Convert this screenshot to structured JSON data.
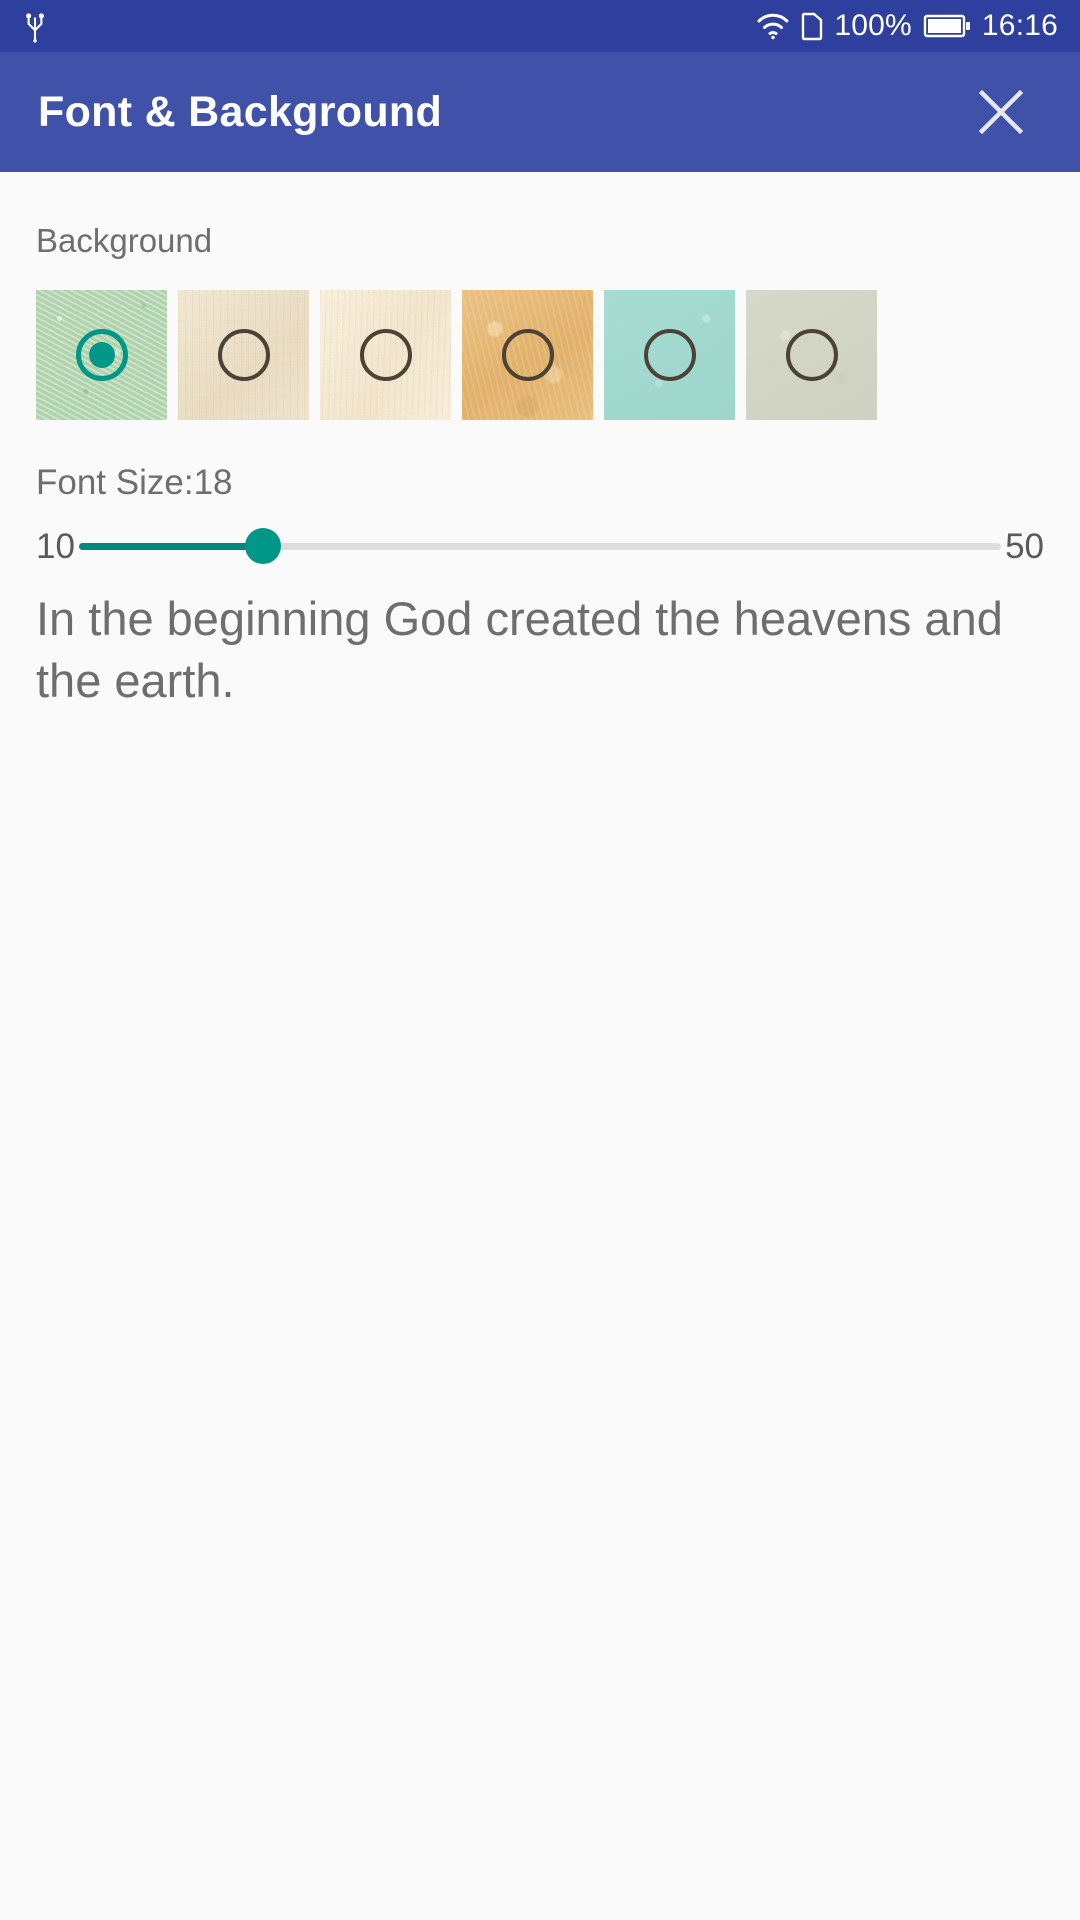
{
  "status_bar": {
    "usb_icon": "usb-icon",
    "wifi_icon": "wifi-icon",
    "sim_icon": "sim-card-icon",
    "battery_percent": "100%",
    "battery_icon": "battery-full-icon",
    "time": "16:16",
    "background_color": "#2E3F9E",
    "foreground_color": "#FFFFFF"
  },
  "app_bar": {
    "title": "Font & Background",
    "close_icon": "close-icon",
    "background_color": "#3F51A8",
    "title_color": "#FFFFFF"
  },
  "content": {
    "background_section": {
      "label": "Background",
      "selected_index": 0,
      "swatches": [
        {
          "name": "sage-green-texture",
          "color": "#B7D8B4",
          "selected": true
        },
        {
          "name": "cream-paper-texture",
          "color": "#EFE3CB",
          "selected": false
        },
        {
          "name": "ivory-paper-texture",
          "color": "#F5EBD7",
          "selected": false
        },
        {
          "name": "sandy-tan-texture",
          "color": "#E6B978",
          "selected": false
        },
        {
          "name": "mint-teal-plain",
          "color": "#A2D9CD",
          "selected": false
        },
        {
          "name": "gray-beige-plain",
          "color": "#D2D4C6",
          "selected": false
        }
      ]
    },
    "font_size_section": {
      "label": "Font Size:18",
      "value": 18,
      "min_label": "10",
      "max_label": "50",
      "min": 10,
      "max": 50,
      "accent_color": "#009688",
      "track_color": "#DDDDDD"
    },
    "preview": {
      "text": "In the beginning God created the heavens and the earth.",
      "text_color": "#6E6E6E"
    },
    "background_color": "#FAFAFA"
  }
}
